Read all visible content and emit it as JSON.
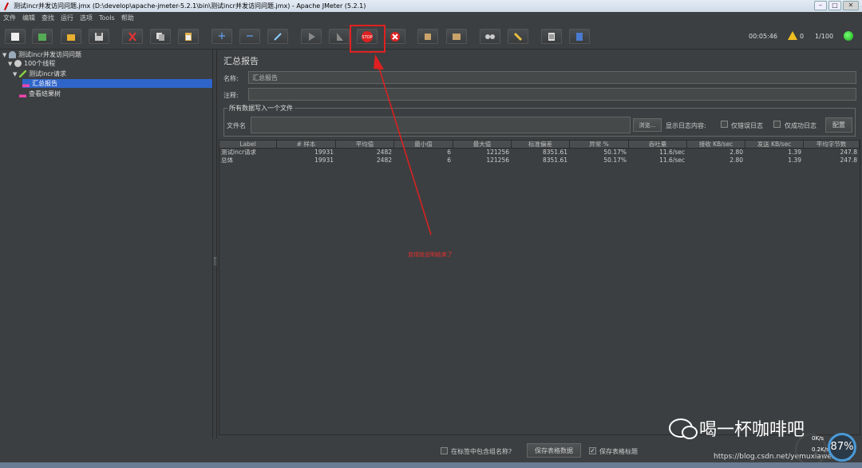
{
  "window": {
    "title": "测试incr并发访问问题.jmx (D:\\develop\\apache-jmeter-5.2.1\\bin\\测试incr并发访问问题.jmx) - Apache JMeter (5.2.1)"
  },
  "menu": [
    "文件",
    "编辑",
    "查找",
    "运行",
    "选项",
    "Tools",
    "帮助"
  ],
  "status": {
    "elapsed": "00:05:46",
    "warnings": "0",
    "threads": "1/100"
  },
  "tree": {
    "items": [
      {
        "label": "测试incr并发访问问题"
      },
      {
        "label": "100个线程"
      },
      {
        "label": "测试incr请求"
      },
      {
        "label": "汇总报告"
      },
      {
        "label": "查看结果树"
      }
    ]
  },
  "panel": {
    "title": "汇总报告",
    "name_label": "名称:",
    "name_value": "汇总报告",
    "comment_label": "注释:",
    "comment_value": "",
    "group_title": "所有数据写入一个文件",
    "file_label": "文件名",
    "browse_label": "浏览...",
    "log_label": "显示日志内容:",
    "errors_only": "仅错误日志",
    "success_only": "仅成功日志",
    "config_label": "配置"
  },
  "table": {
    "headers": [
      "Label",
      "# 样本",
      "平均值",
      "最小值",
      "最大值",
      "标准偏差",
      "异常 %",
      "吞吐量",
      "接收 KB/sec",
      "发送 KB/sec",
      "平均字节数"
    ],
    "rows": [
      [
        "测试incr请求",
        "19931",
        "2482",
        "6",
        "121256",
        "8351.61",
        "50.17%",
        "11.6/sec",
        "2.80",
        "1.39",
        "247.8"
      ],
      [
        "总体",
        "19931",
        "2482",
        "6",
        "121256",
        "8351.61",
        "50.17%",
        "11.6/sec",
        "2.80",
        "1.39",
        "247.8"
      ]
    ]
  },
  "bottom": {
    "include_group": "在标签中包含组名称?",
    "save_data": "保存表格数据",
    "save_header": "保存表格标题"
  },
  "annotation": "变绿就说明结束了",
  "watermark": {
    "text": "喝一杯咖啡吧",
    "url": "https://blog.csdn.net/yemuxiaweiliang"
  },
  "overlay": {
    "percent": "87%",
    "up": "0K/s",
    "down": "0.2K/s"
  },
  "colors": {
    "accent_red": "#e03030",
    "selected": "#2f65ca",
    "background": "#3c3f41"
  }
}
